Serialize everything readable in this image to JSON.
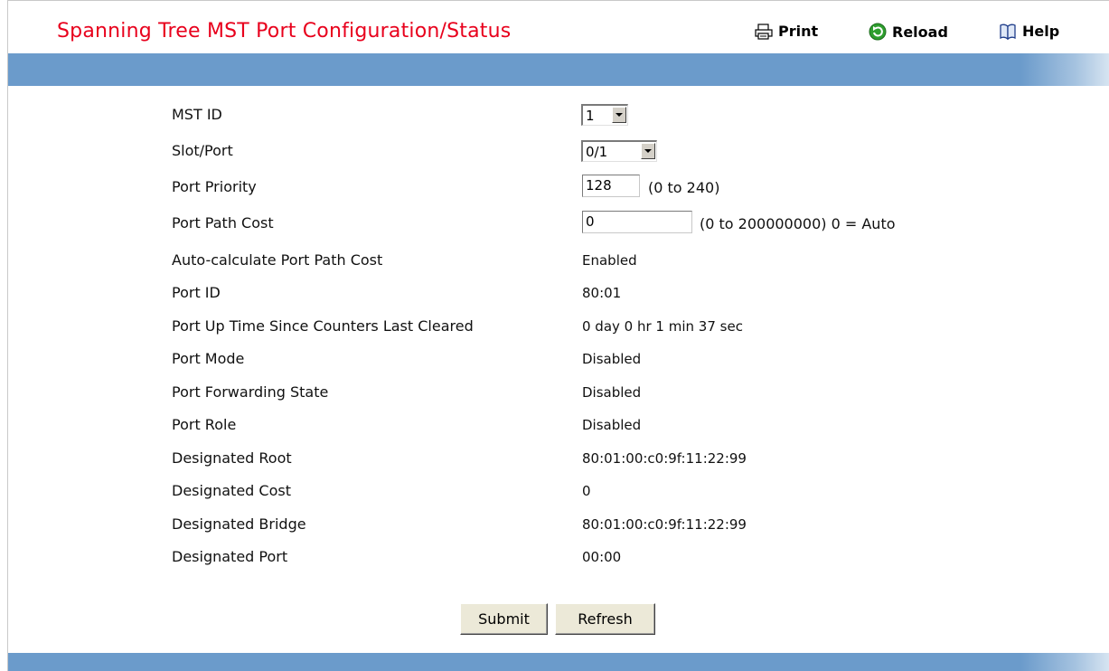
{
  "header": {
    "title": "Spanning Tree MST Port Configuration/Status",
    "print_label": "Print",
    "reload_label": "Reload",
    "help_label": "Help"
  },
  "form": {
    "mst_id": {
      "label": "MST ID",
      "value": "1"
    },
    "slot_port": {
      "label": "Slot/Port",
      "value": "0/1"
    },
    "port_priority": {
      "label": "Port Priority",
      "value": "128",
      "hint": "(0 to 240)"
    },
    "port_path_cost": {
      "label": "Port Path Cost",
      "value": "0",
      "hint": "(0 to 200000000) 0 = Auto"
    },
    "status": [
      {
        "label": "Auto-calculate Port Path Cost",
        "value": "Enabled"
      },
      {
        "label": "Port ID",
        "value": "80:01"
      },
      {
        "label": "Port Up Time Since Counters Last Cleared",
        "value": "0 day 0 hr 1 min 37 sec"
      },
      {
        "label": "Port Mode",
        "value": "Disabled"
      },
      {
        "label": "Port Forwarding State",
        "value": "Disabled"
      },
      {
        "label": "Port Role",
        "value": "Disabled"
      },
      {
        "label": "Designated Root",
        "value": "80:01:00:c0:9f:11:22:99"
      },
      {
        "label": "Designated Cost",
        "value": "0"
      },
      {
        "label": "Designated Bridge",
        "value": "80:01:00:c0:9f:11:22:99"
      },
      {
        "label": "Designated Port",
        "value": "00:00"
      }
    ]
  },
  "buttons": {
    "submit": "Submit",
    "refresh": "Refresh"
  },
  "colors": {
    "title": "#e8001c",
    "bar": "#6b9bcb"
  }
}
